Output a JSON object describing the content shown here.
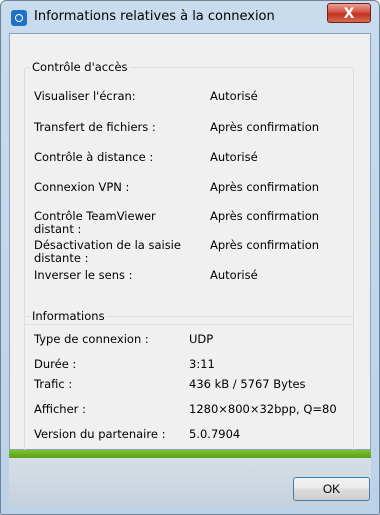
{
  "window": {
    "title": "Informations relatives à la connexion",
    "close_label": "X"
  },
  "access_control": {
    "legend": "Contrôle d'accès",
    "rows": [
      {
        "label": "Visualiser l'écran:",
        "value": "Autorisé"
      },
      {
        "label": "Transfert de fichiers :",
        "value": "Après confirmation"
      },
      {
        "label": "Contrôle à distance :",
        "value": "Autorisé"
      },
      {
        "label": "Connexion VPN :",
        "value": "Après confirmation"
      },
      {
        "label": "Contrôle TeamViewer distant :",
        "value": "Après confirmation"
      },
      {
        "label": "Désactivation de la saisie distante :",
        "value": "Après confirmation"
      },
      {
        "label": "Inverser le sens :",
        "value": "Autorisé"
      }
    ]
  },
  "informations": {
    "legend": "Informations",
    "rows": [
      {
        "label": "Type de connexion :",
        "value": "UDP"
      },
      {
        "label": "Durée :",
        "value": "3:11"
      },
      {
        "label": "Trafic :",
        "value": "436 kB / 5767 Bytes"
      },
      {
        "label": "Afficher :",
        "value": "1280×800×32bpp, Q=80"
      },
      {
        "label": "Version du partenaire :",
        "value": "5.0.7904"
      }
    ]
  },
  "footer": {
    "ok_label": "OK"
  }
}
